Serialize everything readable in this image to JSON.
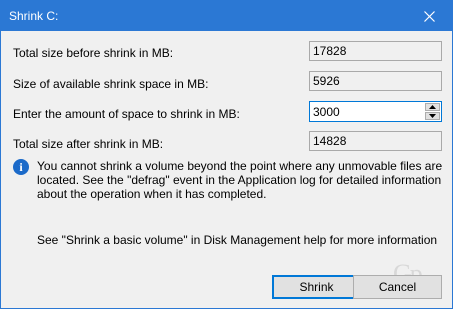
{
  "window": {
    "title": "Shrink C:",
    "title_bg_color": "#2b78d4",
    "close_icon": "close-icon"
  },
  "rows": [
    {
      "label": "Total size before shrink in MB:",
      "value": "17828"
    },
    {
      "label": "Size of available shrink space in MB:",
      "value": "5926"
    },
    {
      "label": "Enter the amount of space to shrink in MB:",
      "value": "3000"
    },
    {
      "label": "Total size after shrink in MB:",
      "value": "14828"
    }
  ],
  "info": {
    "icon": "info-icon",
    "glyph": "i",
    "text": "You cannot shrink a volume beyond the point where any unmovable files are located. See the \"defrag\" event in the Application log for detailed information about the operation when it has completed."
  },
  "help": {
    "text": "See \"Shrink a basic volume\" in Disk Management help for more information"
  },
  "buttons": {
    "shrink_label": "Shrink",
    "cancel_label": "Cancel",
    "accent_color": "#0078d7"
  },
  "watermark": {
    "text": "Gp"
  }
}
